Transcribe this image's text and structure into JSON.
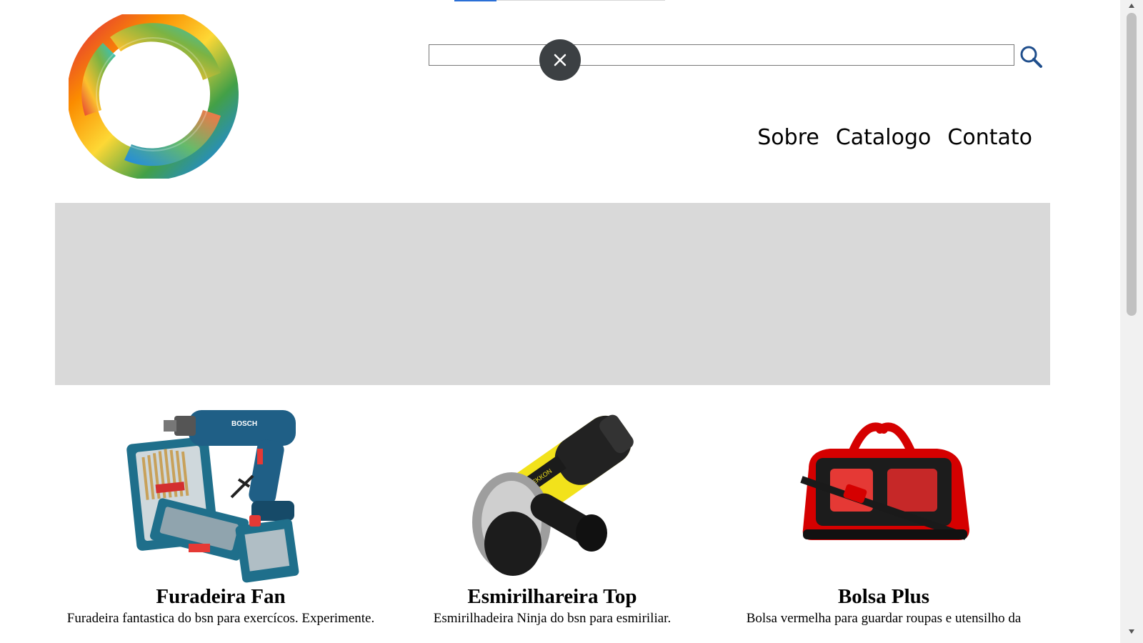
{
  "header": {
    "logo_alt": "logo",
    "search": {
      "value": "",
      "placeholder": ""
    }
  },
  "nav": {
    "items": [
      "Sobre",
      "Catalogo",
      "Contato"
    ]
  },
  "products": [
    {
      "title": "Furadeira Fan",
      "description": "Furadeira fantastica do bsn para exercícos. Experimente."
    },
    {
      "title": "Esmirilhareira Top",
      "description": "Esmirilhadeira Ninja do bsn para esmiriliar."
    },
    {
      "title": "Bolsa Plus",
      "description": "Bolsa vermelha para guardar roupas e utensilho da"
    }
  ],
  "colors": {
    "banner": "#d9d9d9",
    "clear_button": "#3c4043",
    "search_icon": "#1f4e8c"
  },
  "icons": {
    "search": "search-icon",
    "clear": "close-icon"
  }
}
